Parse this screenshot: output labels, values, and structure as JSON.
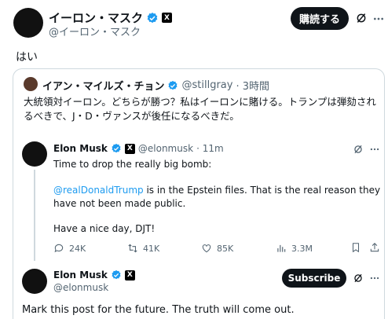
{
  "top_post": {
    "display_name": "イーロン・マスク",
    "handle": "@イーロン・マスク",
    "subscribe_label": "購読する",
    "text": "はい"
  },
  "quoted": {
    "display_name": "イアン・マイルズ・チョン",
    "handle": "@stillgray",
    "time": "· 3時間",
    "text": "大統領対イーロン。どちらが勝つ？私はイーロンに賭ける。トランプは弾劾されるべきで、J・D・ヴァンスが後任になるべきだ。"
  },
  "nested": {
    "display_name": "Elon Musk",
    "handle": "@elonmusk",
    "time": "· 11m",
    "line1": "Time to drop the really big bomb:",
    "mention": "@realDonaldTrump",
    "line2_rest": " is in the Epstein files. That is the real reason they have not been made public.",
    "line3": "Have a nice day, DJT!",
    "stats": {
      "replies": "24K",
      "reposts": "41K",
      "likes": "85K",
      "views": "3.3M"
    }
  },
  "bottom_post": {
    "display_name": "Elon Musk",
    "handle": "@elonmusk",
    "subscribe_label": "Subscribe",
    "text": "Mark this post for the future. The truth will come out."
  },
  "colors": {
    "verified": "#1d9bf0",
    "link": "#1d9bf0",
    "border": "#cfd9de",
    "muted": "#536471"
  }
}
